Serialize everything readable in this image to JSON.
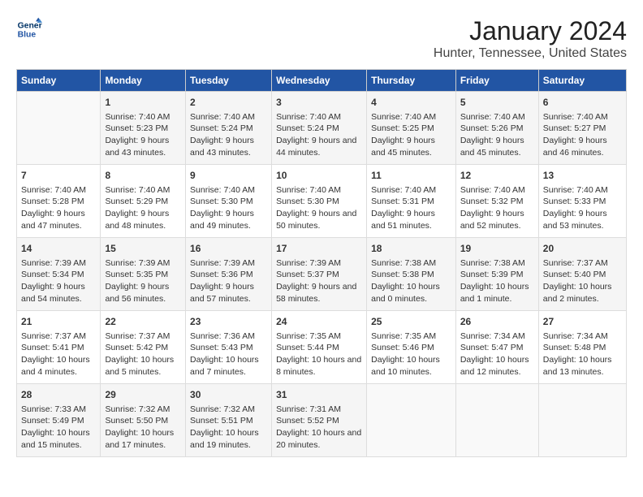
{
  "logo": {
    "text_general": "General",
    "text_blue": "Blue"
  },
  "title": "January 2024",
  "subtitle": "Hunter, Tennessee, United States",
  "headers": [
    "Sunday",
    "Monday",
    "Tuesday",
    "Wednesday",
    "Thursday",
    "Friday",
    "Saturday"
  ],
  "weeks": [
    [
      {
        "day": "",
        "sunrise": "",
        "sunset": "",
        "daylight": ""
      },
      {
        "day": "1",
        "sunrise": "Sunrise: 7:40 AM",
        "sunset": "Sunset: 5:23 PM",
        "daylight": "Daylight: 9 hours and 43 minutes."
      },
      {
        "day": "2",
        "sunrise": "Sunrise: 7:40 AM",
        "sunset": "Sunset: 5:24 PM",
        "daylight": "Daylight: 9 hours and 43 minutes."
      },
      {
        "day": "3",
        "sunrise": "Sunrise: 7:40 AM",
        "sunset": "Sunset: 5:24 PM",
        "daylight": "Daylight: 9 hours and 44 minutes."
      },
      {
        "day": "4",
        "sunrise": "Sunrise: 7:40 AM",
        "sunset": "Sunset: 5:25 PM",
        "daylight": "Daylight: 9 hours and 45 minutes."
      },
      {
        "day": "5",
        "sunrise": "Sunrise: 7:40 AM",
        "sunset": "Sunset: 5:26 PM",
        "daylight": "Daylight: 9 hours and 45 minutes."
      },
      {
        "day": "6",
        "sunrise": "Sunrise: 7:40 AM",
        "sunset": "Sunset: 5:27 PM",
        "daylight": "Daylight: 9 hours and 46 minutes."
      }
    ],
    [
      {
        "day": "7",
        "sunrise": "Sunrise: 7:40 AM",
        "sunset": "Sunset: 5:28 PM",
        "daylight": "Daylight: 9 hours and 47 minutes."
      },
      {
        "day": "8",
        "sunrise": "Sunrise: 7:40 AM",
        "sunset": "Sunset: 5:29 PM",
        "daylight": "Daylight: 9 hours and 48 minutes."
      },
      {
        "day": "9",
        "sunrise": "Sunrise: 7:40 AM",
        "sunset": "Sunset: 5:30 PM",
        "daylight": "Daylight: 9 hours and 49 minutes."
      },
      {
        "day": "10",
        "sunrise": "Sunrise: 7:40 AM",
        "sunset": "Sunset: 5:30 PM",
        "daylight": "Daylight: 9 hours and 50 minutes."
      },
      {
        "day": "11",
        "sunrise": "Sunrise: 7:40 AM",
        "sunset": "Sunset: 5:31 PM",
        "daylight": "Daylight: 9 hours and 51 minutes."
      },
      {
        "day": "12",
        "sunrise": "Sunrise: 7:40 AM",
        "sunset": "Sunset: 5:32 PM",
        "daylight": "Daylight: 9 hours and 52 minutes."
      },
      {
        "day": "13",
        "sunrise": "Sunrise: 7:40 AM",
        "sunset": "Sunset: 5:33 PM",
        "daylight": "Daylight: 9 hours and 53 minutes."
      }
    ],
    [
      {
        "day": "14",
        "sunrise": "Sunrise: 7:39 AM",
        "sunset": "Sunset: 5:34 PM",
        "daylight": "Daylight: 9 hours and 54 minutes."
      },
      {
        "day": "15",
        "sunrise": "Sunrise: 7:39 AM",
        "sunset": "Sunset: 5:35 PM",
        "daylight": "Daylight: 9 hours and 56 minutes."
      },
      {
        "day": "16",
        "sunrise": "Sunrise: 7:39 AM",
        "sunset": "Sunset: 5:36 PM",
        "daylight": "Daylight: 9 hours and 57 minutes."
      },
      {
        "day": "17",
        "sunrise": "Sunrise: 7:39 AM",
        "sunset": "Sunset: 5:37 PM",
        "daylight": "Daylight: 9 hours and 58 minutes."
      },
      {
        "day": "18",
        "sunrise": "Sunrise: 7:38 AM",
        "sunset": "Sunset: 5:38 PM",
        "daylight": "Daylight: 10 hours and 0 minutes."
      },
      {
        "day": "19",
        "sunrise": "Sunrise: 7:38 AM",
        "sunset": "Sunset: 5:39 PM",
        "daylight": "Daylight: 10 hours and 1 minute."
      },
      {
        "day": "20",
        "sunrise": "Sunrise: 7:37 AM",
        "sunset": "Sunset: 5:40 PM",
        "daylight": "Daylight: 10 hours and 2 minutes."
      }
    ],
    [
      {
        "day": "21",
        "sunrise": "Sunrise: 7:37 AM",
        "sunset": "Sunset: 5:41 PM",
        "daylight": "Daylight: 10 hours and 4 minutes."
      },
      {
        "day": "22",
        "sunrise": "Sunrise: 7:37 AM",
        "sunset": "Sunset: 5:42 PM",
        "daylight": "Daylight: 10 hours and 5 minutes."
      },
      {
        "day": "23",
        "sunrise": "Sunrise: 7:36 AM",
        "sunset": "Sunset: 5:43 PM",
        "daylight": "Daylight: 10 hours and 7 minutes."
      },
      {
        "day": "24",
        "sunrise": "Sunrise: 7:35 AM",
        "sunset": "Sunset: 5:44 PM",
        "daylight": "Daylight: 10 hours and 8 minutes."
      },
      {
        "day": "25",
        "sunrise": "Sunrise: 7:35 AM",
        "sunset": "Sunset: 5:46 PM",
        "daylight": "Daylight: 10 hours and 10 minutes."
      },
      {
        "day": "26",
        "sunrise": "Sunrise: 7:34 AM",
        "sunset": "Sunset: 5:47 PM",
        "daylight": "Daylight: 10 hours and 12 minutes."
      },
      {
        "day": "27",
        "sunrise": "Sunrise: 7:34 AM",
        "sunset": "Sunset: 5:48 PM",
        "daylight": "Daylight: 10 hours and 13 minutes."
      }
    ],
    [
      {
        "day": "28",
        "sunrise": "Sunrise: 7:33 AM",
        "sunset": "Sunset: 5:49 PM",
        "daylight": "Daylight: 10 hours and 15 minutes."
      },
      {
        "day": "29",
        "sunrise": "Sunrise: 7:32 AM",
        "sunset": "Sunset: 5:50 PM",
        "daylight": "Daylight: 10 hours and 17 minutes."
      },
      {
        "day": "30",
        "sunrise": "Sunrise: 7:32 AM",
        "sunset": "Sunset: 5:51 PM",
        "daylight": "Daylight: 10 hours and 19 minutes."
      },
      {
        "day": "31",
        "sunrise": "Sunrise: 7:31 AM",
        "sunset": "Sunset: 5:52 PM",
        "daylight": "Daylight: 10 hours and 20 minutes."
      },
      {
        "day": "",
        "sunrise": "",
        "sunset": "",
        "daylight": ""
      },
      {
        "day": "",
        "sunrise": "",
        "sunset": "",
        "daylight": ""
      },
      {
        "day": "",
        "sunrise": "",
        "sunset": "",
        "daylight": ""
      }
    ]
  ]
}
